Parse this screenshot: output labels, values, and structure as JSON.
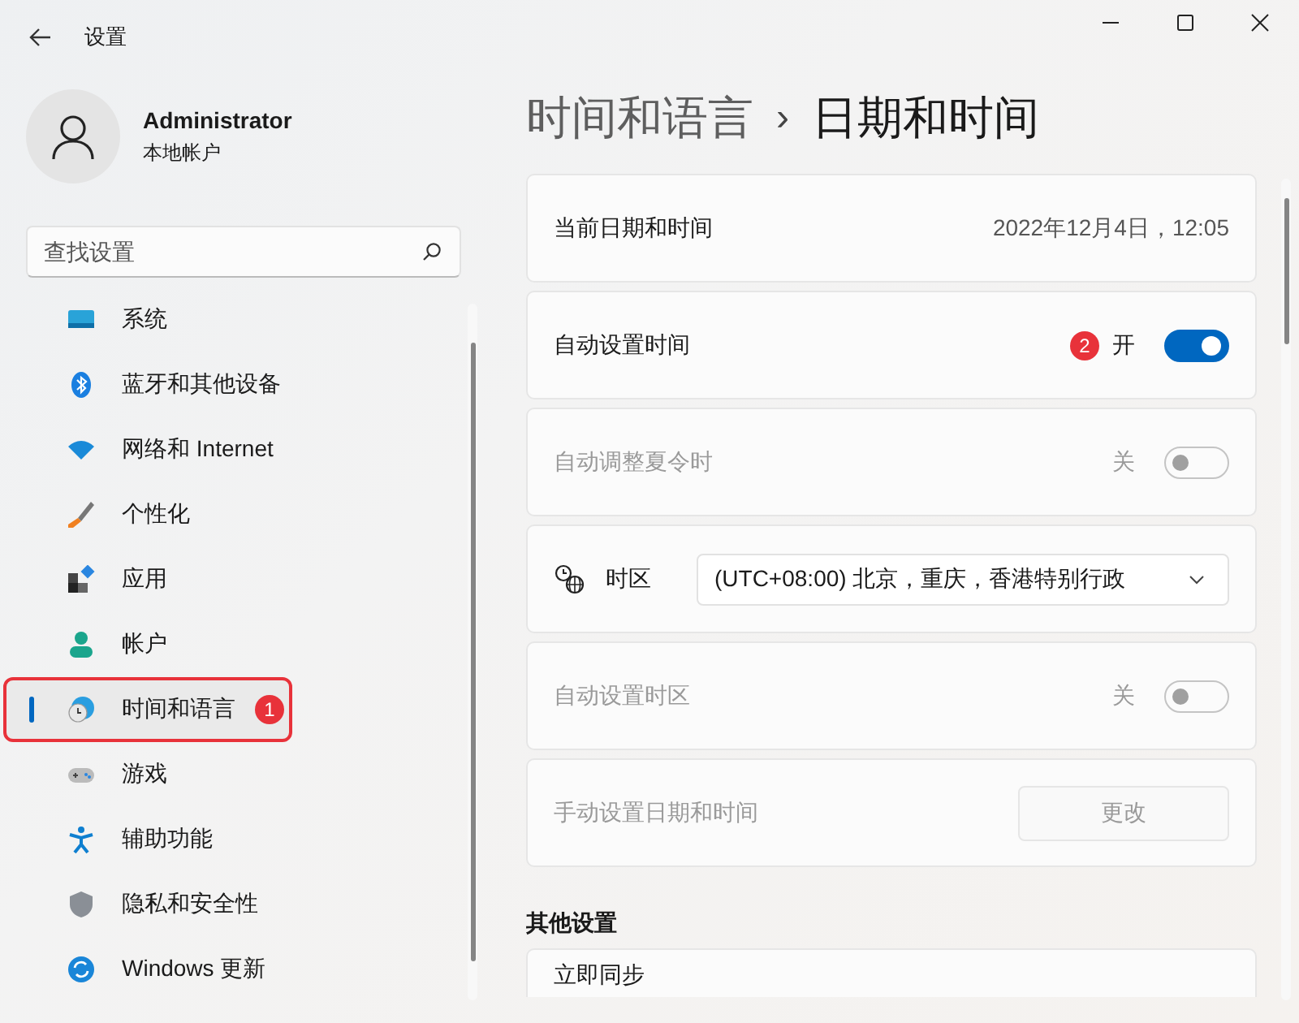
{
  "window": {
    "title": "设置"
  },
  "profile": {
    "name": "Administrator",
    "subtitle": "本地帐户"
  },
  "search": {
    "placeholder": "查找设置"
  },
  "nav": [
    {
      "label": "系统",
      "selected": false
    },
    {
      "label": "蓝牙和其他设备",
      "selected": false
    },
    {
      "label": "网络和 Internet",
      "selected": false
    },
    {
      "label": "个性化",
      "selected": false
    },
    {
      "label": "应用",
      "selected": false
    },
    {
      "label": "帐户",
      "selected": false
    },
    {
      "label": "时间和语言",
      "selected": true,
      "highlighted": true,
      "badge": "1"
    },
    {
      "label": "游戏",
      "selected": false
    },
    {
      "label": "辅助功能",
      "selected": false
    },
    {
      "label": "隐私和安全性",
      "selected": false
    },
    {
      "label": "Windows 更新",
      "selected": false
    }
  ],
  "breadcrumb": {
    "parent": "时间和语言",
    "separator": "›",
    "current": "日期和时间"
  },
  "settings": [
    {
      "kind": "text",
      "label": "当前日期和时间",
      "value": "2022年12月4日，12:05"
    },
    {
      "kind": "toggle",
      "label": "自动设置时间",
      "state_label": "开",
      "on": true,
      "disabled": false,
      "badge": "2"
    },
    {
      "kind": "toggle",
      "label": "自动调整夏令时",
      "state_label": "关",
      "on": false,
      "disabled": true
    },
    {
      "kind": "select",
      "label": "时区",
      "value": "(UTC+08:00) 北京，重庆，香港特别行政"
    },
    {
      "kind": "toggle",
      "label": "自动设置时区",
      "state_label": "关",
      "on": false,
      "disabled": true
    },
    {
      "kind": "button",
      "label": "手动设置日期和时间",
      "button": "更改",
      "disabled": true
    }
  ],
  "other": {
    "heading": "其他设置",
    "items": [
      {
        "label": "立即同步"
      }
    ]
  }
}
